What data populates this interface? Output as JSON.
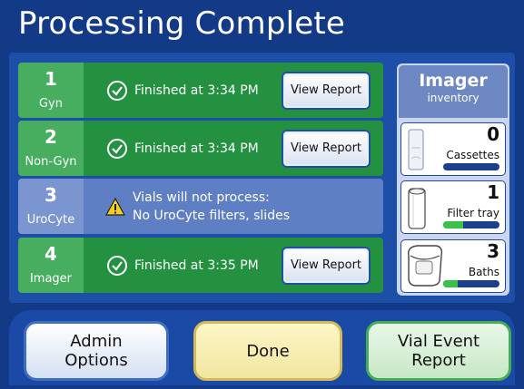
{
  "header": {
    "title": "Processing Complete"
  },
  "rows": [
    {
      "num": "1",
      "label": "Gyn",
      "status": "Finished at  3:34 PM",
      "button": "View Report"
    },
    {
      "num": "2",
      "label": "Non-Gyn",
      "status": "Finished at  3:34 PM",
      "button": "View Report"
    },
    {
      "num": "3",
      "label": "UroCyte",
      "status_line1": "Vials will not process:",
      "status_line2": "No UroCyte filters, slides"
    },
    {
      "num": "4",
      "label": "Imager",
      "status": "Finished at  3:35 PM",
      "button": "View Report"
    }
  ],
  "inventory": {
    "title": "Imager",
    "subtitle": "inventory",
    "items": [
      {
        "count": "0",
        "label": "Cassettes",
        "level": 0
      },
      {
        "count": "1",
        "label": "Filter tray",
        "level": 0.35
      },
      {
        "count": "3",
        "label": "Baths",
        "level": 0.25
      }
    ]
  },
  "footer": {
    "admin_line1": "Admin",
    "admin_line2": "Options",
    "done": "Done",
    "vial_line1": "Vial Event",
    "vial_line2": "Report"
  },
  "colors": {
    "success": "#23913f",
    "warning": "#5f7fc4",
    "accent": "#123a86"
  }
}
